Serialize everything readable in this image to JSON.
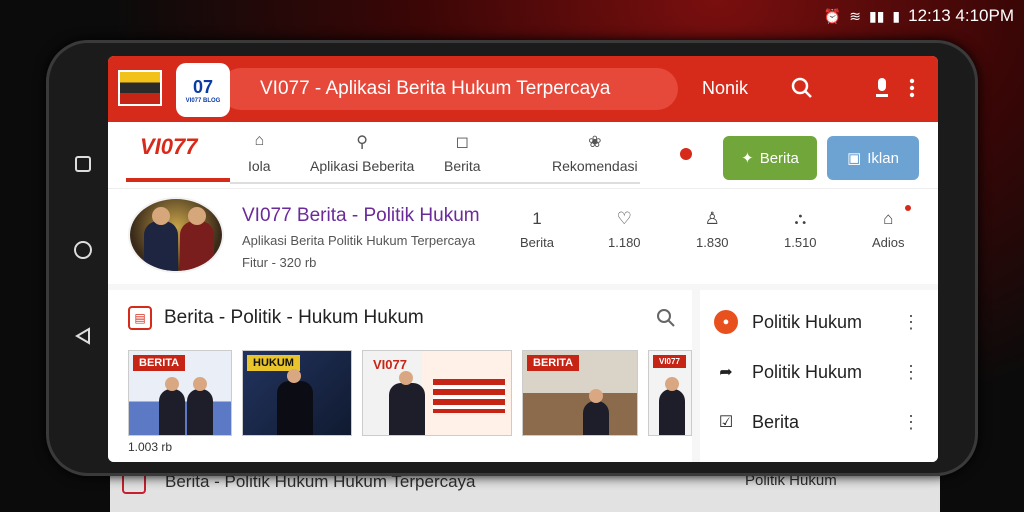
{
  "status": {
    "time": "12:13 4:10PM"
  },
  "appbar": {
    "logo_text": "07",
    "logo_sub": "VI077 BLOG",
    "search_text": "VI077 - Aplikasi Berita Hukum Terpercaya",
    "user_label": "Nonik"
  },
  "tabs": {
    "brand": "VI077",
    "items": [
      {
        "label": "Iola",
        "icon": "home-icon"
      },
      {
        "label": "Aplikasi Beberita",
        "icon": "pin-icon"
      },
      {
        "label": "Berita",
        "icon": "square-icon"
      },
      {
        "label": "Rekomendasi",
        "icon": "gift-icon"
      }
    ],
    "button_green": "Berita",
    "button_blue": "Iklan"
  },
  "profile": {
    "title": "VI077 Berita - Politik Hukum",
    "subtitle": "Aplikasi Berita Politik Hukum Terpercaya",
    "meta": "Fitur - 320 rb",
    "stats": [
      {
        "icon": "number-icon",
        "label": "Berita"
      },
      {
        "icon": "heart-icon",
        "label": "1.180"
      },
      {
        "icon": "user-icon",
        "label": "1.830"
      },
      {
        "icon": "person-icon",
        "label": "1.510"
      },
      {
        "icon": "home-icon",
        "label": "Adios"
      }
    ]
  },
  "feed": {
    "title": "Berita - Politik - Hukum Hukum",
    "thumbs": [
      {
        "label": "BERITA"
      },
      {
        "label": "HUKUM"
      },
      {
        "label": "VI077"
      },
      {
        "label": "BERITA"
      },
      {
        "label": "VI077"
      }
    ],
    "caption": "1.003 rb"
  },
  "side": {
    "items": [
      {
        "label": "Politik Hukum",
        "icon": "badge-icon"
      },
      {
        "label": "Politik Hukum",
        "icon": "share-icon"
      },
      {
        "label": "Berita",
        "icon": "checkbox-icon"
      }
    ]
  },
  "reflection": {
    "left": "Berita - Politik Hukum Hukum Terpercaya",
    "right": "Politik Hukum"
  },
  "colors": {
    "accent": "#d62a1a",
    "green": "#70a63a",
    "blue": "#6da3d3"
  }
}
